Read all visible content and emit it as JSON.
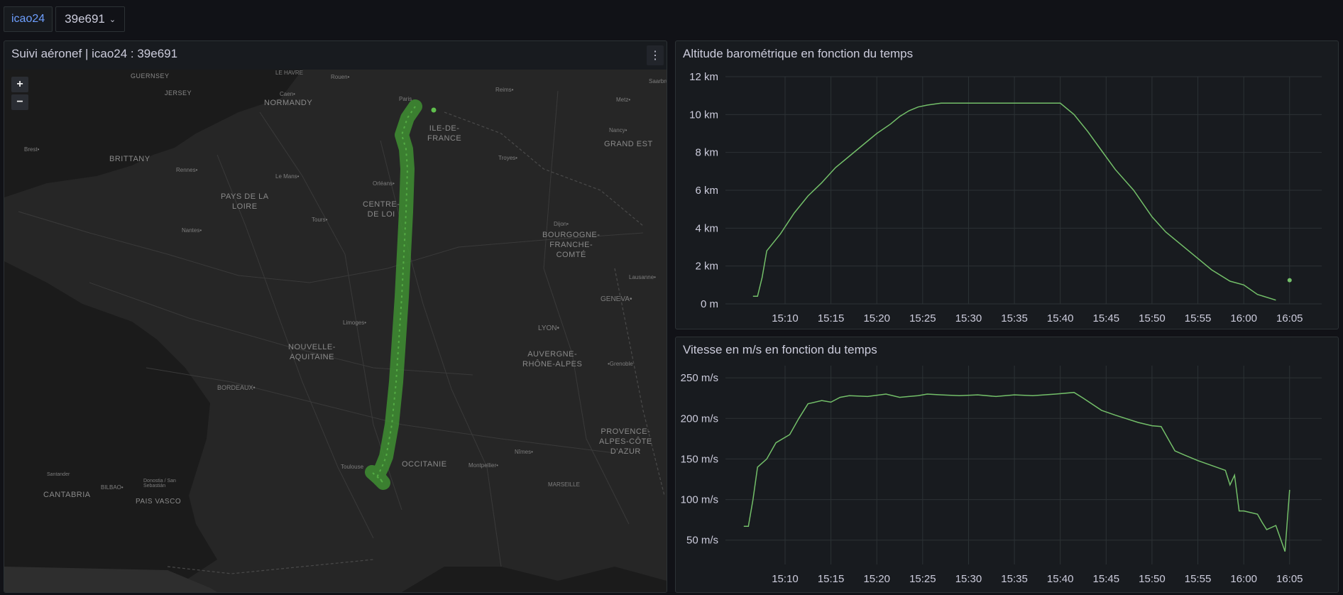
{
  "variable": {
    "label": "icao24",
    "value": "39e691"
  },
  "map_panel": {
    "title": "Suivi aéronef | icao24 : 39e691",
    "zoom_in": "+",
    "zoom_out": "−",
    "regions": [
      "NORMANDY",
      "ILE-DE-\nFRANCE",
      "GRAND EST",
      "BRITTANY",
      "PAYS DE LA\nLOIRE",
      "CENTRE-\nDE LOI",
      "BOURGOGNE-\nFRANCHE-\nCOMTÉ",
      "NOUVELLE-\nAQUITAINE",
      "AUVERGNE-\nRHÔNE-ALPES",
      "OCCITANIE",
      "PROVENCE-\nALPES-CÔTE\nD'AZUR",
      "CANTABRIA",
      "GUERNSEY",
      "JERSEY",
      "PAIS VASCO"
    ],
    "cities": [
      "Caen•",
      "Rouen•",
      "Reims•",
      "Metz•",
      "Saarbrück",
      "LE HAVRE",
      "Paris",
      "Nancy•",
      "Troyes•",
      "Rennes•",
      "Le Mans•",
      "Orléans•",
      "Tours•",
      "Dijon•",
      "Nantes•",
      "Brest•",
      "Lausanne•",
      "GENEVA•",
      "Limoges•",
      "LYON•",
      "•Grenoble",
      "BORDEAUX•",
      "Nîmes•",
      "Toulouse",
      "Montpellier•",
      "MARSEILLE",
      "BILBAO•",
      "Donostia / San Sebastián",
      "Santander"
    ],
    "track_color": "#5fbf4d"
  },
  "altitude_chart": {
    "title": "Altitude barométrique en fonction du temps",
    "chart_data": {
      "type": "line",
      "title": "Altitude barométrique en fonction du temps",
      "xlabel": "",
      "ylabel": "",
      "y_ticks": [
        "0 m",
        "2 km",
        "4 km",
        "6 km",
        "8 km",
        "10 km",
        "12 km"
      ],
      "ylim_km": [
        0,
        12
      ],
      "x_ticks": [
        "15:10",
        "15:15",
        "15:20",
        "15:25",
        "15:30",
        "15:35",
        "15:40",
        "15:45",
        "15:50",
        "15:55",
        "16:00",
        "16:05"
      ],
      "x_minutes_since_15_00": [
        6.5,
        7.0,
        7.5,
        8.0,
        9.5,
        11.0,
        12.5,
        14.0,
        15.5,
        17.0,
        18.5,
        20.0,
        21.5,
        22.5,
        23.5,
        24.5,
        25.5,
        27.0,
        28.0,
        30.0,
        35.0,
        40.0,
        41.5,
        43.0,
        44.5,
        46.0,
        48.0,
        50.0,
        51.5,
        53.0,
        54.5,
        56.5,
        58.5,
        60.0,
        61.5,
        63.5
      ],
      "y_km": [
        0.4,
        0.4,
        1.4,
        2.8,
        3.7,
        4.8,
        5.7,
        6.4,
        7.2,
        7.8,
        8.4,
        9.0,
        9.5,
        9.9,
        10.2,
        10.4,
        10.5,
        10.6,
        10.6,
        10.6,
        10.6,
        10.6,
        10.0,
        9.1,
        8.1,
        7.1,
        6.0,
        4.6,
        3.8,
        3.2,
        2.6,
        1.8,
        1.2,
        1.0,
        0.5,
        0.2
      ],
      "extra_point": {
        "x": 65.0,
        "y": 1.25
      },
      "color": "#73bf69",
      "grid": true
    }
  },
  "speed_chart": {
    "title": "Vitesse en m/s en fonction du temps",
    "chart_data": {
      "type": "line",
      "title": "Vitesse en m/s en fonction du temps",
      "xlabel": "",
      "ylabel": "",
      "y_ticks": [
        "50 m/s",
        "100 m/s",
        "150 m/s",
        "200 m/s",
        "250 m/s"
      ],
      "ylim": [
        20,
        260
      ],
      "x_ticks": [
        "15:10",
        "15:15",
        "15:20",
        "15:25",
        "15:30",
        "15:35",
        "15:40",
        "15:45",
        "15:50",
        "15:55",
        "16:00",
        "16:05"
      ],
      "x_minutes_since_15_00": [
        5.5,
        6.0,
        6.5,
        7.0,
        8.0,
        9.0,
        10.5,
        11.5,
        12.5,
        14.0,
        15.0,
        16.0,
        17.0,
        19.0,
        21.0,
        22.5,
        23.5,
        24.5,
        25.5,
        27.0,
        29.0,
        31.0,
        33.0,
        35.0,
        37.0,
        39.5,
        41.5,
        42.5,
        44.5,
        46.0,
        48.5,
        50.0,
        51.0,
        52.5,
        53.5,
        55.0,
        58.0,
        58.5,
        59.0,
        59.5,
        60.0,
        61.5,
        62.0,
        62.5,
        63.5,
        64.5,
        65.0
      ],
      "y": [
        67,
        67,
        100,
        140,
        150,
        170,
        180,
        200,
        218,
        222,
        220,
        226,
        228,
        227,
        230,
        226,
        227,
        228,
        230,
        229,
        228,
        229,
        227,
        229,
        228,
        230,
        232,
        225,
        210,
        204,
        195,
        191,
        190,
        160,
        155,
        148,
        136,
        118,
        130,
        86,
        86,
        82,
        72,
        63,
        68,
        36,
        112
      ],
      "color": "#73bf69",
      "grid": true
    }
  }
}
